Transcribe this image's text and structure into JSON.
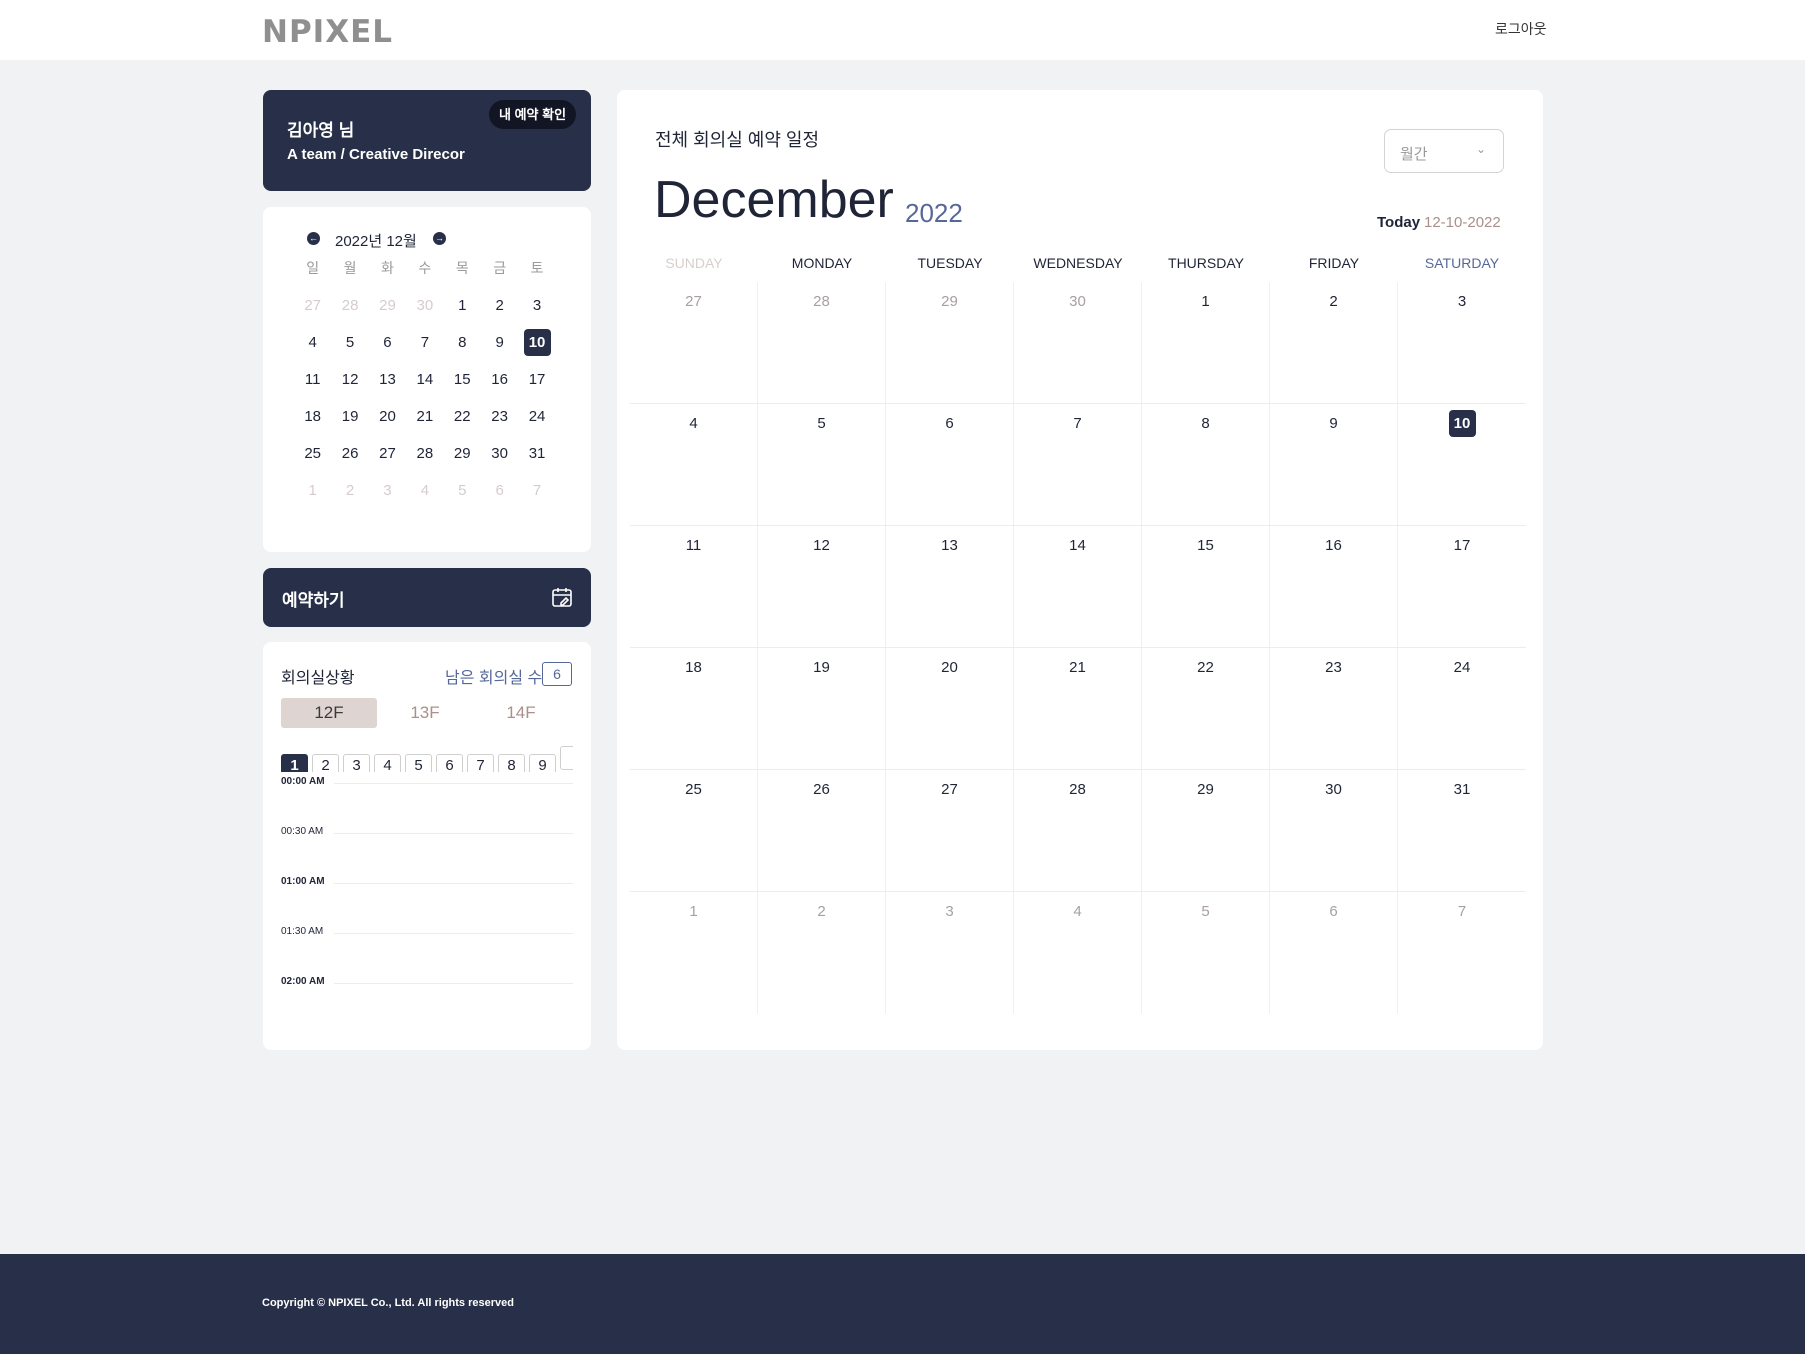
{
  "header": {
    "logo": "NPIXEL",
    "logout": "로그아웃"
  },
  "profile": {
    "name": "김아영 님",
    "role": "A team / Creative Direcor",
    "my_reservation": "내 예약 확인"
  },
  "mini_calendar": {
    "title": "2022년 12월",
    "prev": "←",
    "next": "→",
    "weekdays": [
      "일",
      "월",
      "화",
      "수",
      "목",
      "금",
      "토"
    ],
    "days": [
      {
        "n": "27",
        "muted": true
      },
      {
        "n": "28",
        "muted": true
      },
      {
        "n": "29",
        "muted": true
      },
      {
        "n": "30",
        "muted": true
      },
      {
        "n": "1"
      },
      {
        "n": "2"
      },
      {
        "n": "3"
      },
      {
        "n": "4"
      },
      {
        "n": "5"
      },
      {
        "n": "6"
      },
      {
        "n": "7"
      },
      {
        "n": "8"
      },
      {
        "n": "9"
      },
      {
        "n": "10",
        "today": true
      },
      {
        "n": "11"
      },
      {
        "n": "12"
      },
      {
        "n": "13"
      },
      {
        "n": "14"
      },
      {
        "n": "15"
      },
      {
        "n": "16"
      },
      {
        "n": "17"
      },
      {
        "n": "18"
      },
      {
        "n": "19"
      },
      {
        "n": "20"
      },
      {
        "n": "21"
      },
      {
        "n": "22"
      },
      {
        "n": "23"
      },
      {
        "n": "24"
      },
      {
        "n": "25"
      },
      {
        "n": "26"
      },
      {
        "n": "27"
      },
      {
        "n": "28"
      },
      {
        "n": "29"
      },
      {
        "n": "30"
      },
      {
        "n": "31"
      },
      {
        "n": "1",
        "muted": true
      },
      {
        "n": "2",
        "muted": true
      },
      {
        "n": "3",
        "muted": true
      },
      {
        "n": "4",
        "muted": true
      },
      {
        "n": "5",
        "muted": true
      },
      {
        "n": "6",
        "muted": true
      },
      {
        "n": "7",
        "muted": true
      }
    ]
  },
  "reserve": {
    "label": "예약하기",
    "icon": "calendar-edit-icon"
  },
  "rooms": {
    "title": "회의실상황",
    "remain_label": "남은 회의실 수",
    "remain_count": "6",
    "floors": [
      {
        "label": "12F",
        "active": true
      },
      {
        "label": "13F",
        "active": false
      },
      {
        "label": "14F",
        "active": false
      }
    ],
    "room_numbers": [
      "1",
      "2",
      "3",
      "4",
      "5",
      "6",
      "7",
      "8",
      "9",
      ""
    ],
    "active_room": "1",
    "time_slots": [
      {
        "label": "00:00 AM",
        "bold": true
      },
      {
        "label": "00:30 AM",
        "bold": false
      },
      {
        "label": "01:00 AM",
        "bold": true
      },
      {
        "label": "01:30 AM",
        "bold": false
      },
      {
        "label": "02:00 AM",
        "bold": true
      }
    ]
  },
  "main": {
    "heading": "전체 회의실 예약 일정",
    "view_select": "월간",
    "month": "December",
    "year": "2022",
    "today_label": "Today",
    "today_value": "12-10-2022",
    "weekdays": [
      "SUNDAY",
      "MONDAY",
      "TUESDAY",
      "WEDNESDAY",
      "THURSDAY",
      "FRIDAY",
      "SATURDAY"
    ],
    "days": [
      {
        "n": "27",
        "muted": true
      },
      {
        "n": "28",
        "muted": true
      },
      {
        "n": "29",
        "muted": true
      },
      {
        "n": "30",
        "muted": true
      },
      {
        "n": "1"
      },
      {
        "n": "2"
      },
      {
        "n": "3"
      },
      {
        "n": "4"
      },
      {
        "n": "5"
      },
      {
        "n": "6"
      },
      {
        "n": "7"
      },
      {
        "n": "8"
      },
      {
        "n": "9"
      },
      {
        "n": "10",
        "today": true
      },
      {
        "n": "11"
      },
      {
        "n": "12"
      },
      {
        "n": "13"
      },
      {
        "n": "14"
      },
      {
        "n": "15"
      },
      {
        "n": "16"
      },
      {
        "n": "17"
      },
      {
        "n": "18"
      },
      {
        "n": "19"
      },
      {
        "n": "20"
      },
      {
        "n": "21"
      },
      {
        "n": "22"
      },
      {
        "n": "23"
      },
      {
        "n": "24"
      },
      {
        "n": "25"
      },
      {
        "n": "26"
      },
      {
        "n": "27"
      },
      {
        "n": "28"
      },
      {
        "n": "29"
      },
      {
        "n": "30"
      },
      {
        "n": "31"
      },
      {
        "n": "1",
        "muted": true
      },
      {
        "n": "2",
        "muted": true
      },
      {
        "n": "3",
        "muted": true
      },
      {
        "n": "4",
        "muted": true
      },
      {
        "n": "5",
        "muted": true
      },
      {
        "n": "6",
        "muted": true
      },
      {
        "n": "7",
        "muted": true
      }
    ]
  },
  "footer": {
    "copyright": "Copyright © NPIXEL Co., Ltd. All rights reserved"
  },
  "colors": {
    "navy": "#283049",
    "accent_blue": "#56689a",
    "muted_rose": "#a9908b",
    "floor_active_bg": "#ded5d3"
  }
}
